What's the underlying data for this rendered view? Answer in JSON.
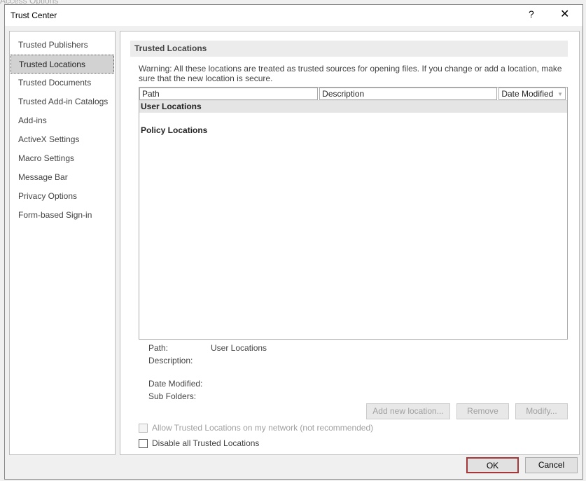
{
  "background_window": {
    "title": "Access Options"
  },
  "dialog": {
    "title": "Trust Center",
    "help": "?",
    "close": "✕"
  },
  "nav": {
    "items": [
      "Trusted Publishers",
      "Trusted Locations",
      "Trusted Documents",
      "Trusted Add-in Catalogs",
      "Add-ins",
      "ActiveX Settings",
      "Macro Settings",
      "Message Bar",
      "Privacy Options",
      "Form-based Sign-in"
    ],
    "selected": "Trusted Locations"
  },
  "main": {
    "section_title": "Trusted Locations",
    "warning": "Warning: All these locations are treated as trusted sources for opening files.  If you change or add a location, make sure that the new location is secure.",
    "columns": [
      "Path",
      "Description",
      "Date Modified"
    ],
    "sort_icon": "▼",
    "groups": [
      "User Locations",
      "Policy Locations"
    ],
    "details": {
      "path_label": "Path:",
      "path_value": "User Locations",
      "description_label": "Description:",
      "date_label": "Date Modified:",
      "sub_label": "Sub Folders:"
    },
    "buttons": {
      "add": "Add new location...",
      "remove": "Remove",
      "modify": "Modify..."
    },
    "allow_network": {
      "label": "Allow Trusted Locations on my network (not recommended)",
      "checked": false,
      "enabled": false
    },
    "disable_all": {
      "label": "Disable all Trusted Locations",
      "checked": false
    }
  },
  "footer": {
    "ok": "OK",
    "cancel": "Cancel"
  }
}
